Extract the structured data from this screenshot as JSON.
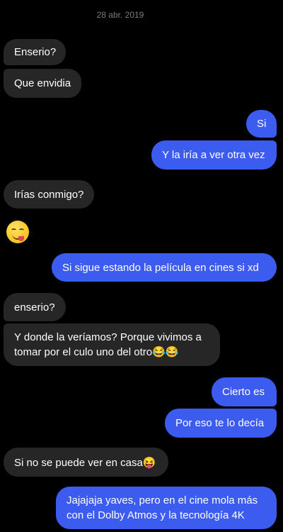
{
  "conversation": {
    "date": "28 abr. 2019",
    "messages": [
      {
        "side": "in",
        "text": "Enserio?"
      },
      {
        "side": "in",
        "text": "Que envidia"
      },
      {
        "side": "out",
        "text": "Si"
      },
      {
        "side": "out",
        "text": "Y la iría a ver otra vez"
      },
      {
        "side": "in",
        "text": "Irías conmigo?"
      },
      {
        "side": "in",
        "text": "😋",
        "type": "emoji",
        "icon": "savoring-food-face-icon"
      },
      {
        "side": "out",
        "text": "Si sigue estando la película en cines si xd"
      },
      {
        "side": "in",
        "text": "enserio?"
      },
      {
        "side": "in",
        "text": "Y donde la veríamos? Porque vivimos a tomar por el culo uno del otro😂😂"
      },
      {
        "side": "out",
        "text": "Cierto es"
      },
      {
        "side": "out",
        "text": "Por eso te lo decía"
      },
      {
        "side": "in",
        "text": "Si no se puede ver en casa😝"
      },
      {
        "side": "out",
        "text": "Jajajaja yaves, pero en el cine mola más con el Dolby Atmos y la tecnología 4K"
      }
    ]
  },
  "colors": {
    "background": "#000000",
    "incoming_bubble": "#262626",
    "outgoing_bubble": "#3c5cf0",
    "text": "#ffffff",
    "date_text": "#7a7a7a"
  }
}
